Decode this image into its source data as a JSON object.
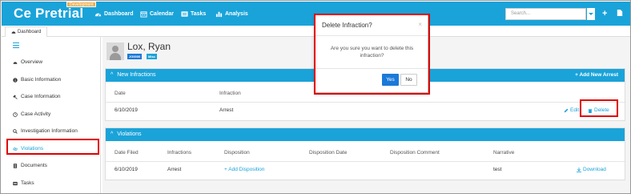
{
  "navbar": {
    "brand": "Ce Pretrial",
    "env_badge": "Development",
    "items": [
      {
        "label": "Dashboard",
        "icon": "dashboard-icon"
      },
      {
        "label": "Calendar",
        "icon": "calendar-icon"
      },
      {
        "label": "Tasks",
        "icon": "tasks-icon"
      },
      {
        "label": "Analysis",
        "icon": "chart-icon"
      }
    ],
    "search_placeholder": "Search...",
    "accent": "#1aa3d9"
  },
  "tabs": {
    "dashboard": "Dashboard"
  },
  "sidebar": {
    "items": [
      {
        "label": "Overview",
        "icon": "overview-icon"
      },
      {
        "label": "Basic Information",
        "icon": "info-icon"
      },
      {
        "label": "Case Information",
        "icon": "gavel-icon"
      },
      {
        "label": "Case Activity",
        "icon": "clock-icon"
      },
      {
        "label": "Investigation Information",
        "icon": "search-icon"
      },
      {
        "label": "Violations",
        "icon": "link-icon"
      },
      {
        "label": "Documents",
        "icon": "documents-icon"
      },
      {
        "label": "Tasks",
        "icon": "tasks-icon"
      }
    ],
    "active": "Violations"
  },
  "person": {
    "name": "Lox, Ryan",
    "tags": [
      "JG0000",
      "Misc"
    ]
  },
  "infractions": {
    "title": "New Infractions",
    "add_label": "Add New Arrest",
    "headers": [
      "Date",
      "Infraction"
    ],
    "rows": [
      {
        "date": "6/10/2019",
        "infraction": "Arrest",
        "edit": "Edit",
        "delete": "Delete"
      }
    ]
  },
  "violations": {
    "title": "Violations",
    "headers": [
      "Date Filed",
      "Infractions",
      "Disposition",
      "Disposition Date",
      "Disposition Comment",
      "Narrative"
    ],
    "rows": [
      {
        "date_filed": "6/10/2019",
        "infractions": "Arrest",
        "disposition": "Add Disposition",
        "disposition_date": "",
        "disposition_comment": "",
        "narrative": "test",
        "download": "Download"
      }
    ]
  },
  "modal": {
    "title": "Delete Infraction?",
    "message": "Are you sure you want to delete this infraction?",
    "yes": "Yes",
    "no": "No"
  },
  "colors": {
    "highlight": "#e00000",
    "primary_button": "#1b79d8"
  }
}
